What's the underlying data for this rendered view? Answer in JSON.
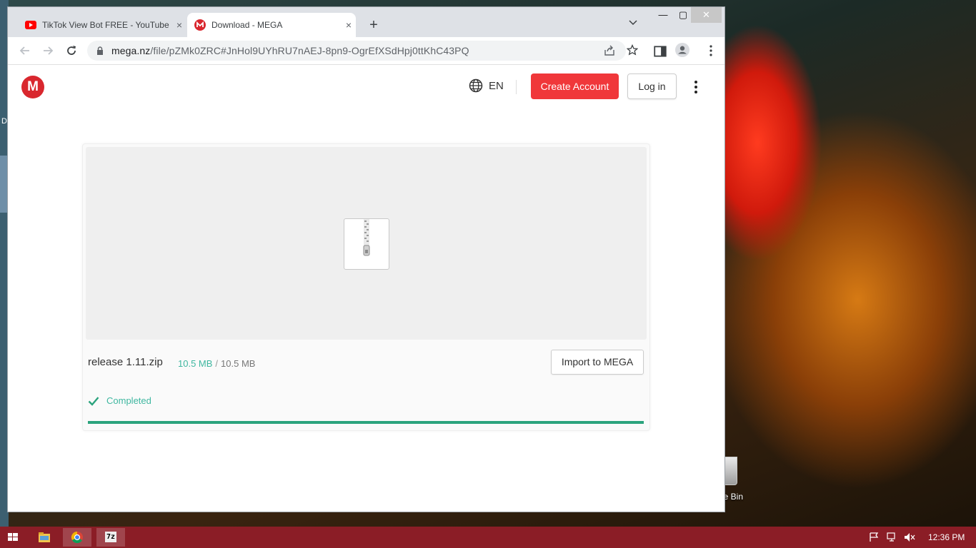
{
  "desktop": {
    "left_label": "D",
    "recycle_bin_label": "le Bin"
  },
  "browser": {
    "tabs": [
      {
        "title": "TikTok View Bot FREE - YouTube",
        "favicon": "youtube-icon",
        "active": false
      },
      {
        "title": "Download - MEGA",
        "favicon": "mega-icon",
        "active": true
      }
    ],
    "new_tab_label": "+",
    "tab_close_glyph": "×",
    "url": {
      "host": "mega.nz",
      "path": "/file/pZMk0ZRC#JnHol9UYhRU7nAEJ-8pn9-OgrEfXSdHpj0ttKhC43PQ"
    },
    "window_controls": {
      "minimize": "—",
      "maximize": "▢",
      "close": "✕"
    }
  },
  "mega": {
    "logo_letter": "M",
    "language": "EN",
    "create_account_label": "Create Account",
    "login_label": "Log in",
    "file": {
      "name": "release 1.11.zip",
      "downloaded": "10.5 MB",
      "separator": "/",
      "total": "10.5 MB",
      "status": "Completed",
      "progress_fraction": 1.0
    },
    "import_label": "Import to MEGA",
    "colors": {
      "brand_red": "#d9272e",
      "button_red": "#f0373a",
      "success_green": "#2ba37d"
    }
  },
  "taskbar": {
    "clock": "12:36 PM",
    "apps": [
      "windows-start-icon",
      "file-explorer-icon",
      "chrome-icon",
      "7zip-icon"
    ],
    "sevenzip_label": "7z",
    "color": "#8b1d26"
  }
}
